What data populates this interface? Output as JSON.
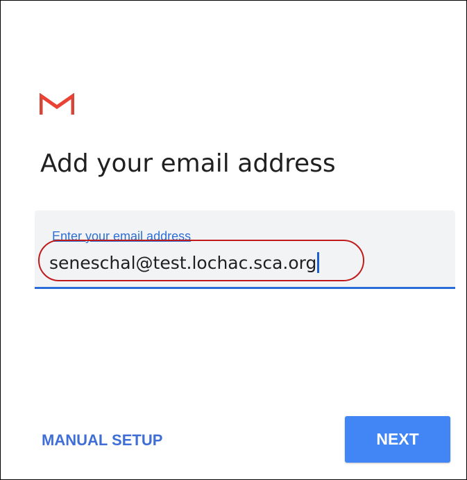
{
  "header": {
    "logo_icon": "gmail-m-icon",
    "title": "Add your email address"
  },
  "email_field": {
    "label": "Enter your email address",
    "value": "seneschal@test.lochac.sca.org",
    "focused": true,
    "highlighted": true
  },
  "actions": {
    "manual_setup_label": "MANUAL SETUP",
    "next_label": "NEXT"
  },
  "colors": {
    "accent": "#4285f4",
    "link": "#3f6ed6",
    "field_bg": "#f2f3f5",
    "highlight": "#c01a1a",
    "gmail_red": "#d44638"
  }
}
